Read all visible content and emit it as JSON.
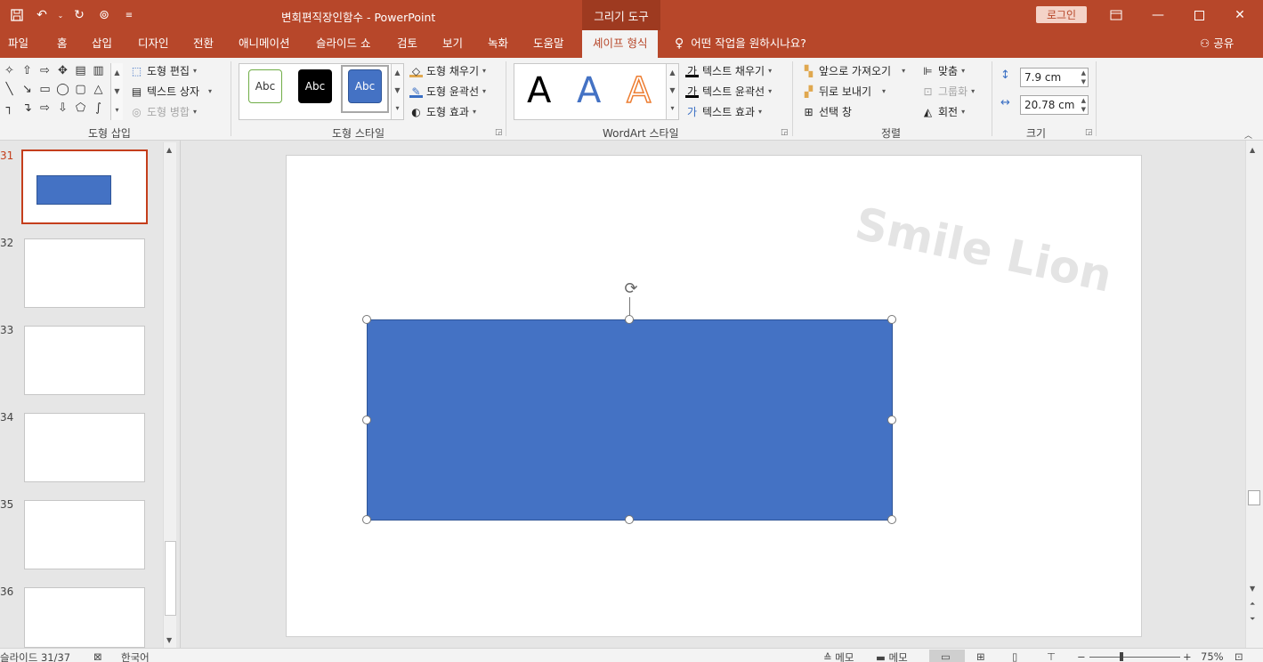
{
  "window": {
    "title": "변회편직장인함수  -  PowerPoint",
    "context_tab_group": "그리기 도구",
    "login_label": "로그인"
  },
  "tabs": [
    "파일",
    "홈",
    "삽입",
    "디자인",
    "전환",
    "애니메이션",
    "슬라이드 쇼",
    "검토",
    "보기",
    "녹화",
    "도움말"
  ],
  "active_tab": "셰이프 형식",
  "tell_me": "어떤 작업을 원하시나요?",
  "share_label": "공유",
  "ribbon": {
    "insert_shapes": {
      "label": "도형 삽입",
      "edit_shape": "도형 편집",
      "text_box": "텍스트 상자",
      "merge_shapes": "도형 병합"
    },
    "shape_styles": {
      "label": "도형 스타일",
      "preset_text": "Abc",
      "fill": "도형 채우기",
      "outline": "도형 윤곽선",
      "effects": "도형 효과"
    },
    "wordart": {
      "label": "WordArt 스타일",
      "letter": "A",
      "text_fill": "텍스트 채우기",
      "text_outline": "텍스트 윤곽선",
      "text_effects": "텍스트 효과"
    },
    "arrange": {
      "label": "정렬",
      "bring_forward": "앞으로 가져오기",
      "send_backward": "뒤로 보내기",
      "selection_pane": "선택 창",
      "align": "맞춤",
      "group": "그룹화",
      "rotate": "회전"
    },
    "size": {
      "label": "크기",
      "height": "7.9 cm",
      "width": "20.78 cm"
    }
  },
  "thumbnails": [
    {
      "num": "31",
      "active": true
    },
    {
      "num": "32",
      "active": false
    },
    {
      "num": "33",
      "active": false
    },
    {
      "num": "34",
      "active": false
    },
    {
      "num": "35",
      "active": false
    },
    {
      "num": "36",
      "active": false
    }
  ],
  "slide": {
    "watermark": "Smile Lion",
    "shape_color": "#4472c4"
  },
  "status": {
    "slide_counter": "슬라이드 31/37",
    "language": "한국어",
    "notes": "메모",
    "comments": "메모",
    "zoom": "75%"
  },
  "colors": {
    "accent": "#b7472a",
    "shape_fill": "#4472c4"
  }
}
